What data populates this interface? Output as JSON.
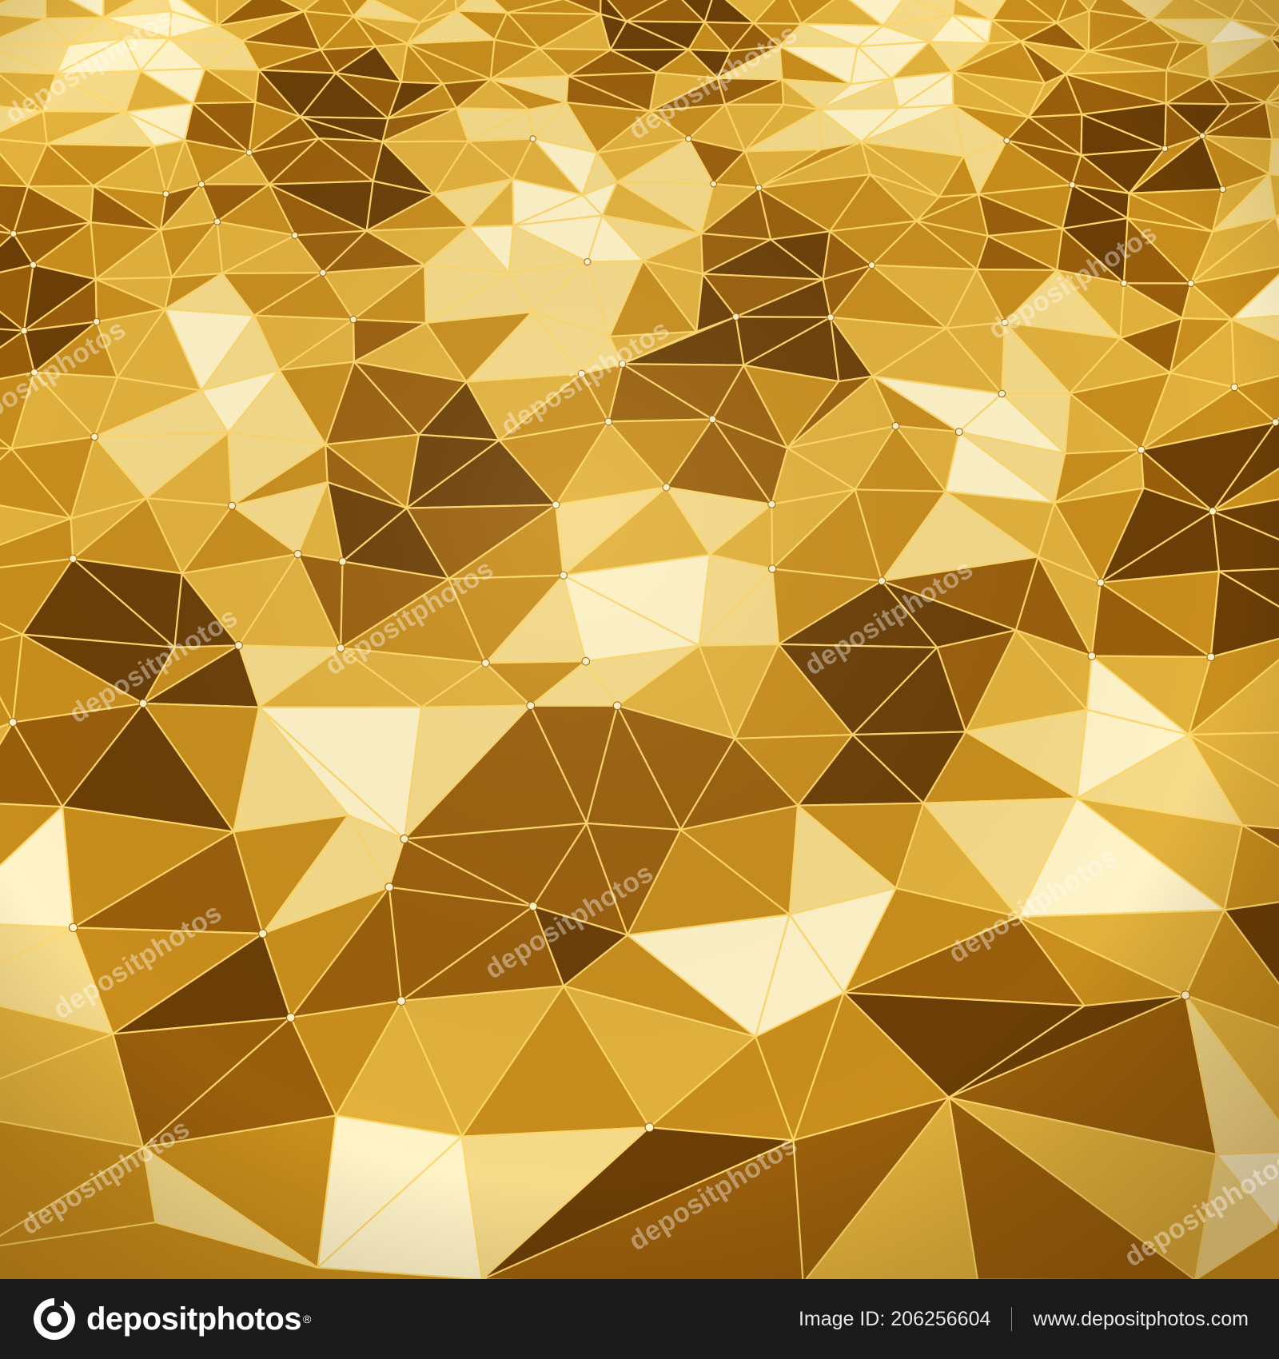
{
  "image": {
    "subject": "gold low-poly faceted surface with wire edges",
    "palette": {
      "deep": "#6b3e06",
      "dark": "#9a5f0c",
      "mid": "#c98e1c",
      "warm": "#e3b23c",
      "light": "#f6db8a",
      "highlight": "#fff3c8",
      "wire": "#ffd86a"
    }
  },
  "watermark": {
    "text": "depositphotos"
  },
  "footer": {
    "logo_text": "depositphotos",
    "logo_mark": "registered-mark",
    "image_id": "Image ID: 206256604",
    "site": "www.depositphotos.com",
    "background": "#1a1a1a"
  }
}
